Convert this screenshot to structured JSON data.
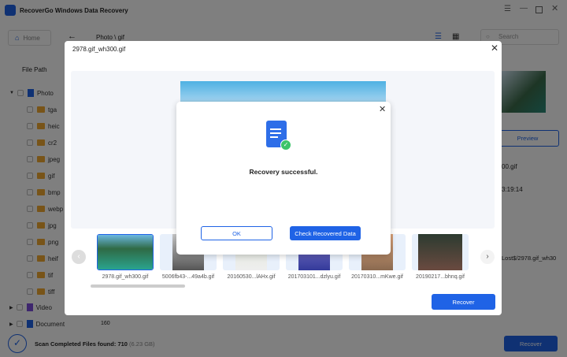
{
  "app": {
    "title": "RecoverGo Windows Data Recovery"
  },
  "toolbar": {
    "home": "Home",
    "breadcrumb": "Photo \\ gif",
    "search_placeholder": "Search"
  },
  "sidebar": {
    "tab": "File Path",
    "items": [
      {
        "label": "Photo",
        "type": "root"
      },
      {
        "label": "tga"
      },
      {
        "label": "heic"
      },
      {
        "label": "cr2"
      },
      {
        "label": "jpeg"
      },
      {
        "label": "gif",
        "selected": true
      },
      {
        "label": "bmp"
      },
      {
        "label": "webp"
      },
      {
        "label": "jpg"
      },
      {
        "label": "png"
      },
      {
        "label": "heif"
      },
      {
        "label": "tif"
      },
      {
        "label": "tiff"
      },
      {
        "label": "Video",
        "type": "root"
      },
      {
        "label": "Document",
        "type": "root"
      }
    ]
  },
  "right_panel": {
    "preview_button": "Preview",
    "name": "00.gif",
    "time": "3:19:14",
    "path": "Lost$/2978.gif_wh30"
  },
  "background": {
    "count": "160"
  },
  "status": {
    "label": "Scan Completed Files found:",
    "count": "710",
    "size": "(6.23 GB)",
    "recover": "Recover"
  },
  "preview_modal": {
    "title": "2978.gif_wh300.gif",
    "recover": "Recover",
    "thumbnails": [
      {
        "label": "2978.gif_wh300.gif",
        "selected": true
      },
      {
        "label": "5006fb43-...49a4b.gif"
      },
      {
        "label": "20160530...lAHx.gif"
      },
      {
        "label": "201703101...dzlyu.gif"
      },
      {
        "label": "20170310...mKwe.gif"
      },
      {
        "label": "20190217...bhnq.gif"
      }
    ]
  },
  "success_dialog": {
    "message": "Recovery successful.",
    "ok": "OK",
    "check": "Check Recovered Data"
  },
  "colors": {
    "accent": "#1f63e6",
    "folder": "#f0a830"
  }
}
